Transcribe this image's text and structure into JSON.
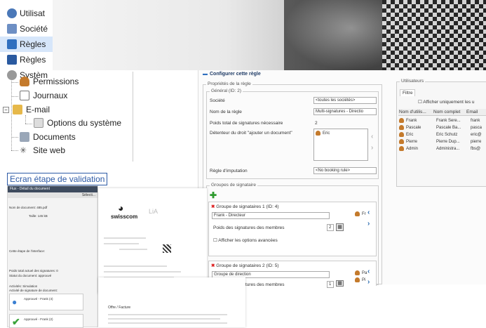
{
  "tree_top": [
    {
      "label": "Utilisat",
      "icon": "users-icon",
      "color": "#4a78b8"
    },
    {
      "label": "Société",
      "icon": "company-icon",
      "color": "#4a78b8"
    },
    {
      "label": "Règles",
      "icon": "rules-icon",
      "color": "#2f6fbf",
      "selected": true
    },
    {
      "label": "Règles",
      "icon": "rules-book-icon",
      "color": "#2a5aa0"
    },
    {
      "label": "Systèm",
      "icon": "system-gear-icon",
      "color": "#8a8a8a"
    }
  ],
  "tree_bottom": {
    "permissions": "Permissions",
    "journaux": "Journaux",
    "email": "E-mail",
    "options": "Options du système",
    "documents": "Documents",
    "site_web": "Site web"
  },
  "window": {
    "title": "Configurer cette règle",
    "props_legend": "Propriétés de la règle",
    "general_legend": "Général (ID: 2)",
    "societe_label": "Société",
    "societe_value": "<toutes les sociétés>",
    "nom_label": "Nom de la règle",
    "nom_value": "Multi-signatures - Directio",
    "poids_label": "Poids total de signatures nécessaire",
    "poids_value": "2",
    "detenteur_label": "Détenteur du droit \"ajouter un document\"",
    "detenteur_value": "Eric",
    "imputation_label": "Règle d'imputation",
    "imputation_value": "<No booking rule>",
    "groupes_legend": "Groupes de signataire",
    "group1": {
      "title": "Groupe de signataires 1 (ID: 4)",
      "name": "Frank - Directeur",
      "poids_label": "Poids des signatures des membres",
      "poids_value": "2",
      "options_label": "Afficher les options avancées",
      "member": "Fr"
    },
    "group2": {
      "title": "Groupe de signataires 2 (ID: 5)",
      "name": "Groupe de direction",
      "poids_label": "Poids des signatures des membres",
      "poids_value": "1",
      "members": [
        "Pa",
        "Pi"
      ]
    },
    "users_legend": "Utilisateurs",
    "filtre_tab": "Filtre",
    "filter_checkbox": "Afficher uniquement les u",
    "users_headers": [
      "Nom d'utilis...",
      "Nom complet",
      "Email"
    ],
    "users": [
      [
        "Frank",
        "Frank Sere...",
        "frank"
      ],
      [
        "Pascale",
        "Pascale Ba...",
        "pasca"
      ],
      [
        "Eric",
        "Eric Schutz",
        "eric@"
      ],
      [
        "Pierre",
        "Pierre Dup...",
        "pierre"
      ],
      [
        "Admin",
        "Administra...",
        "fbs@"
      ]
    ]
  },
  "preview": {
    "ecran_label": "Ecran étape de validation",
    "doc_header": "Flux - Détail du document",
    "selection": "Sélecti...",
    "doc_no_label": "Nom de document:",
    "doc_no_value": "485.pdf",
    "tailles": "Taille: 145 kB",
    "etape": "Cette étape de l'interface:",
    "poids_total": "Poids total actuel des signatures: 0",
    "statut": "Statut du document: approuvé",
    "activites": "Activités: Simulation",
    "activites2": "Activité de signature de document:",
    "approve1": "Approuvé - Frank (4)",
    "approve2": "Approuvé - Frank (2)",
    "brand": "swisscom",
    "brand_right": "LiA",
    "invoice_label": "Offre / Facture"
  }
}
